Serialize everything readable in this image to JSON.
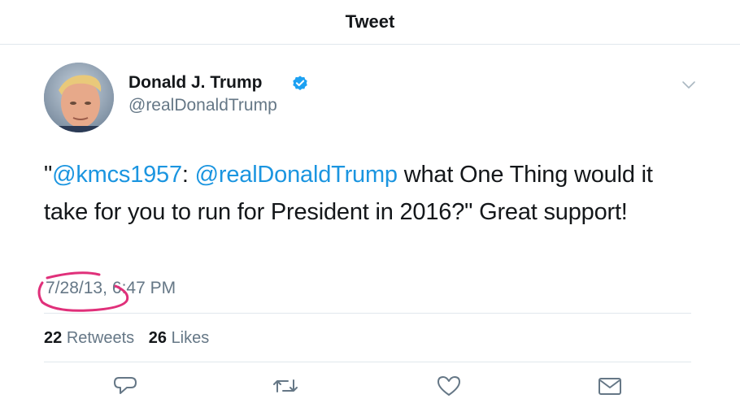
{
  "header": {
    "title": "Tweet"
  },
  "author": {
    "name": "Donald J. Trump",
    "handle": "@realDonaldTrump",
    "verified": true
  },
  "tweet": {
    "quote_open": "\"",
    "mention1": "@kmcs1957",
    "colon": ": ",
    "mention2": "@realDonaldTrump",
    "body": " what One Thing would it take for you to run for President in 2016?\" Great support!",
    "date": "7/28/13,",
    "time": "6:47 PM"
  },
  "stats": {
    "retweets_count": "22",
    "retweets_label": "Retweets",
    "likes_count": "26",
    "likes_label": "Likes"
  },
  "actions": [
    "reply-icon",
    "retweet-icon",
    "like-icon",
    "dm-icon"
  ],
  "colors": {
    "link": "#1b95e0",
    "verified": "#1da1f2",
    "annotation": "#e0307a",
    "muted": "#657786"
  }
}
